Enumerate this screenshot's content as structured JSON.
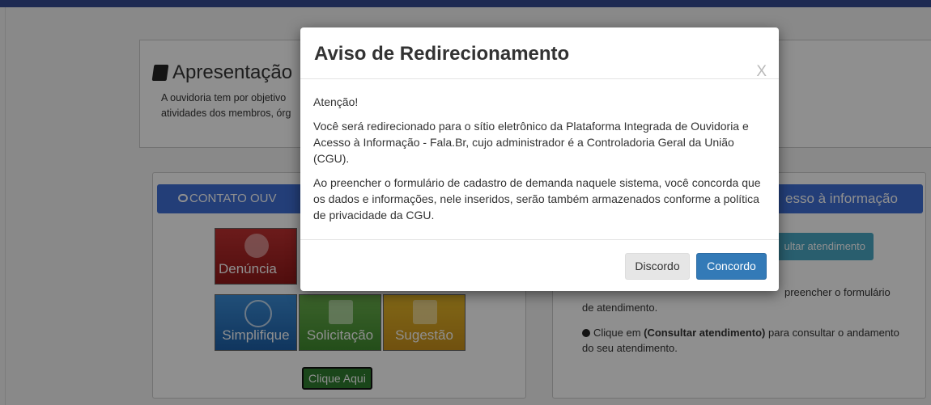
{
  "background": {
    "apresentacao": {
      "title": "Apresentação",
      "text_line1": "A ouvidoria tem por objetivo",
      "text_line2": "atividades dos membros, órg"
    },
    "contato": {
      "header": "CONTATO OUV",
      "tiles": [
        "Denúncia",
        "Simplifique",
        "Solicitação",
        "Sugestão"
      ],
      "clique_button": "Clique Aqui"
    },
    "acesso": {
      "header": "esso à informação",
      "consultar_button": "ultar atendimento",
      "text1_a": "preencher o formulário",
      "text1_b": "de atendimento.",
      "text2_prefix": "Clique em ",
      "text2_bold": "(Consultar atendimento)",
      "text2_suffix": " para consultar o andamento do seu atendimento."
    }
  },
  "modal": {
    "title": "Aviso de Redirecionamento",
    "close": "X",
    "p1": "Atenção!",
    "p2": "Você será redirecionado para o sítio eletrônico da Plataforma Integrada de Ouvidoria e Acesso à Informação - Fala.Br, cujo administrador é a Controladoria Geral da União (CGU).",
    "p3": "Ao preencher o formulário de cadastro de demanda naquele sistema, você concorda que os dados e informações, nele inseridos, serão também armazenados conforme a política de privacidade da CGU.",
    "discordo": "Discordo",
    "concordo": "Concordo"
  },
  "colors": {
    "primary": "#337ab7",
    "header_blue": "#3f6fd6",
    "topbar": "#1e2a52"
  }
}
